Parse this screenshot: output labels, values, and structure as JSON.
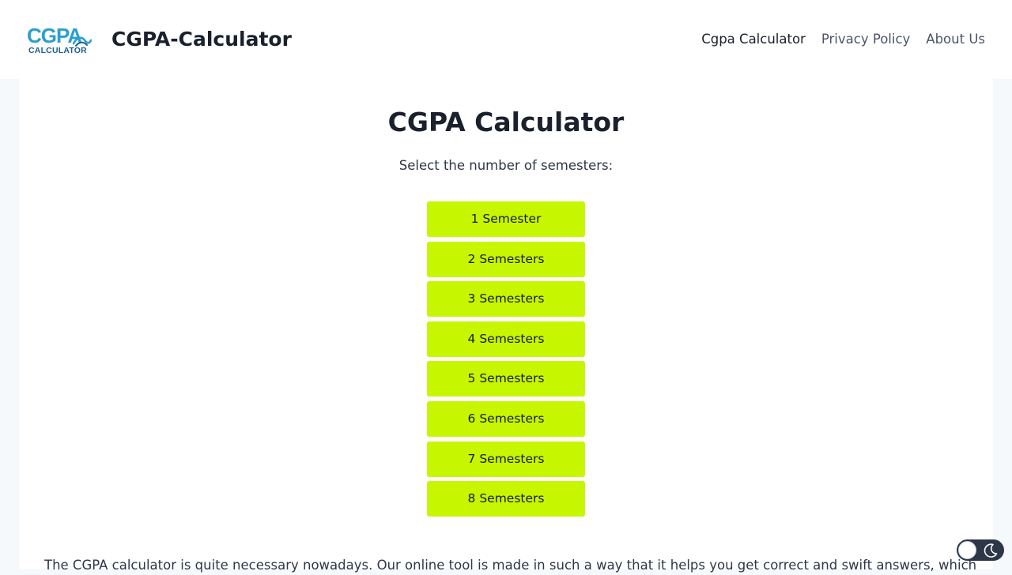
{
  "header": {
    "logo": {
      "top_text": "CGPA",
      "bottom_text": "CALCULATOR",
      "icon": "wave-swoosh-icon"
    },
    "site_title": "CGPA-Calculator",
    "nav": [
      {
        "label": "Cgpa Calculator",
        "active": true
      },
      {
        "label": "Privacy Policy",
        "active": false
      },
      {
        "label": "About Us",
        "active": false
      }
    ]
  },
  "main": {
    "title": "CGPA Calculator",
    "subtitle": "Select the number of semesters:",
    "semester_buttons": [
      "1 Semester",
      "2 Semesters",
      "3 Semesters",
      "4 Semesters",
      "5 Semesters",
      "6 Semesters",
      "7 Semesters",
      "8 Semesters"
    ],
    "button_color": "#c6f700",
    "intro_text": "The CGPA calculator is quite necessary nowadays. Our online tool is made in such a way that it helps you get correct and swift answers, which saves"
  },
  "theme_toggle": {
    "icons": [
      "sun-icon",
      "moon-icon"
    ]
  },
  "colors": {
    "page_background": "#f6f9fc",
    "heading": "#1a202c",
    "nav_text": "#4a5568",
    "logo_blue": "#2b9fd0"
  }
}
